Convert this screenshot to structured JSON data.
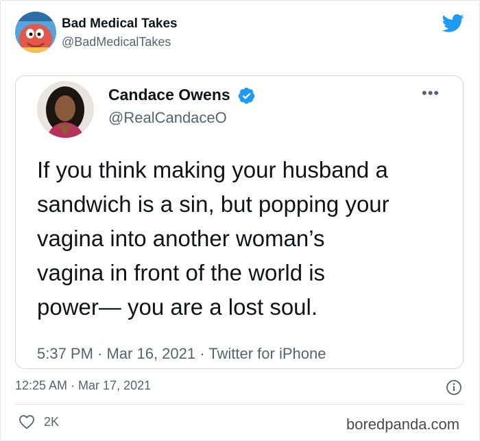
{
  "tweet": {
    "author": {
      "name": "Bad Medical Takes",
      "handle": "@BadMedicalTakes",
      "avatar": "zoidberg-avatar"
    },
    "timestamp": "12:25 AM · Mar 17, 2021",
    "likes": "2K"
  },
  "quoted_tweet": {
    "author": {
      "name": "Candace Owens",
      "handle": "@RealCandaceO",
      "verified": true,
      "avatar": "portrait-avatar"
    },
    "text_lines": [
      "If you think making your husband a",
      "sandwich is a sin, but popping your",
      "vagina into another woman’s",
      "vagina in front of the world is",
      "power— you are a lost soul."
    ],
    "meta": "5:37 PM · Mar 16, 2021 · Twitter for iPhone"
  },
  "icons": {
    "bird": "twitter-bird-icon",
    "verified": "verified-badge-icon",
    "more": "more-options-icon",
    "info": "info-icon",
    "heart": "heart-icon"
  },
  "colors": {
    "brand": "#1d9bf0",
    "text": "#0f1419",
    "muted": "#536471",
    "border": "#cfd9de"
  },
  "watermark": "boredpanda.com"
}
